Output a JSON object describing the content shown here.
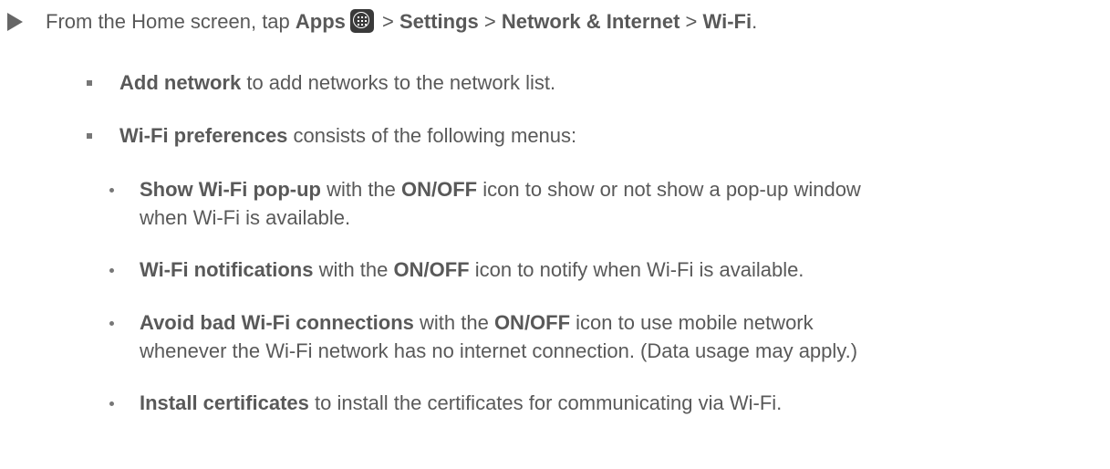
{
  "step": {
    "prefix": "From the Home screen, tap ",
    "apps": "Apps",
    "apps_icon": "apps-grid-icon",
    "sep1": " > ",
    "settings": "Settings",
    "sep2": " > ",
    "network": "Network & Internet",
    "sep3": " > ",
    "wifi": "Wi-Fi",
    "end": "."
  },
  "bullets": [
    {
      "bold": "Add network",
      "rest": " to add networks to the network list."
    },
    {
      "bold": "Wi-Fi preferences",
      "rest": " consists of the following menus:"
    }
  ],
  "sub_items": [
    {
      "bold": "Show Wi-Fi pop-up",
      "mid": " with the ",
      "bold2": "ON/OFF",
      "rest": " icon to show or not show a pop-up window",
      "line2": "when Wi-Fi is available."
    },
    {
      "bold": "Wi-Fi notifications",
      "mid": " with the ",
      "bold2": "ON/OFF",
      "rest": " icon to notify when Wi-Fi is available."
    },
    {
      "bold": "Avoid bad Wi-Fi connections",
      "mid": " with the ",
      "bold2": "ON/OFF",
      "rest": " icon to use mobile network",
      "line2": "whenever the Wi-Fi network has no internet connection. (Data usage may apply.)"
    },
    {
      "bold": "Install certificates",
      "rest": " to install the certificates for communicating via Wi-Fi."
    }
  ]
}
